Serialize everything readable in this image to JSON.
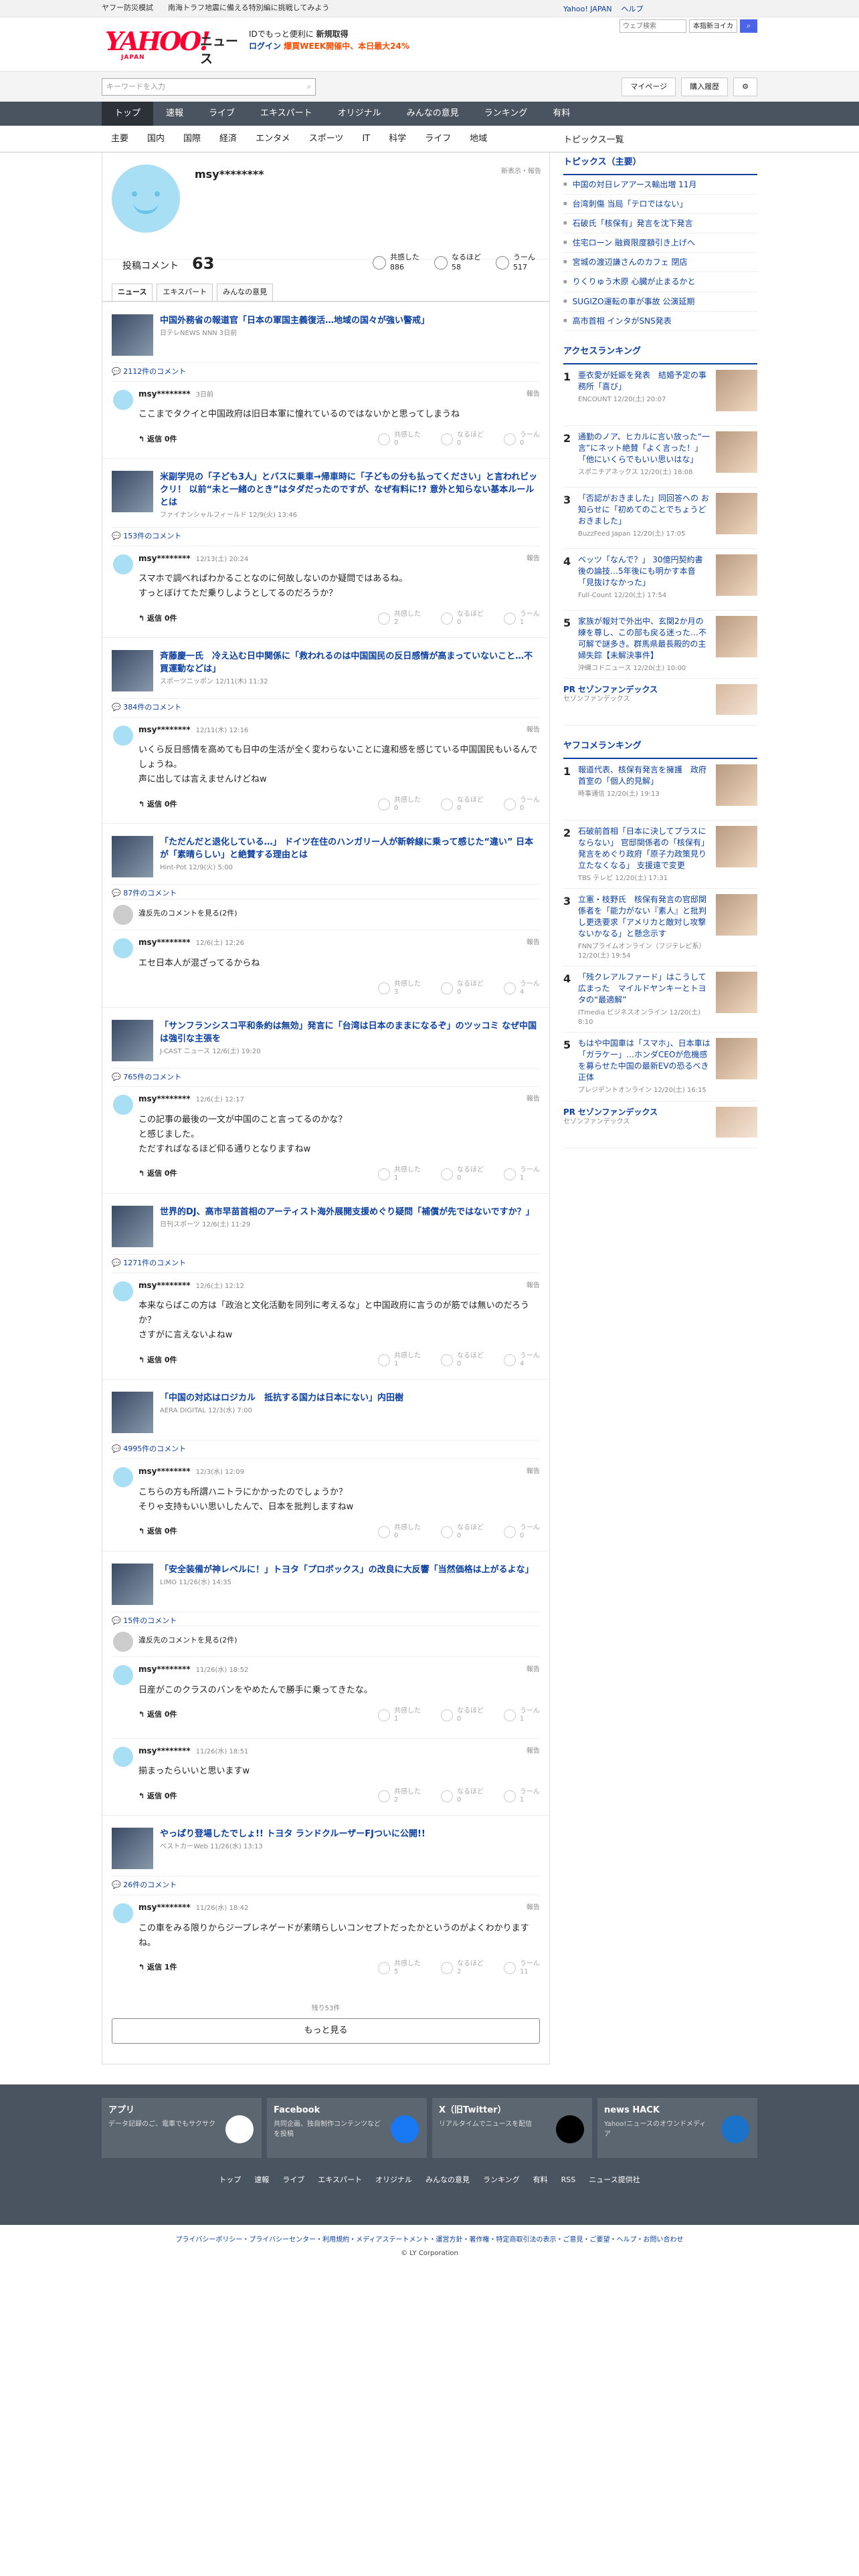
{
  "topbar": {
    "left": [
      "ヤフー防災模試",
      "南海トラフ地震に備える特別編に挑戦してみよう"
    ],
    "right": [
      "Yahoo! JAPAN",
      "ヘルプ"
    ]
  },
  "header": {
    "logo": "YAHOO!",
    "logo_sub": "JAPAN",
    "service": "ニュース",
    "promo1": "IDでもっと便利に",
    "promo1b": "新規取得",
    "promo2": "ログイン",
    "promo2b": "爆買WEEK開催中、本日最大24%",
    "search_placeholder": "ウェブ検索",
    "search_scope": "本指新ヨイカ"
  },
  "searchrow": {
    "placeholder": "キーワードを入力",
    "mypage": "マイページ",
    "history": "購入履歴"
  },
  "nav": [
    "トップ",
    "速報",
    "ライブ",
    "エキスパート",
    "オリジナル",
    "みんなの意見",
    "ランキング",
    "有料"
  ],
  "subnav": [
    "主要",
    "国内",
    "国際",
    "経済",
    "エンタメ",
    "スポーツ",
    "IT",
    "科学",
    "ライフ",
    "地域"
  ],
  "subnav_right": "トピックス一覧",
  "profile": {
    "name": "msy********",
    "note": "新表示・報告",
    "posted_label": "投稿コメント",
    "posted": "63",
    "stats": [
      {
        "label": "共感した",
        "value": "886"
      },
      {
        "label": "なるほど",
        "value": "58"
      },
      {
        "label": "うーん",
        "value": "517"
      }
    ]
  },
  "tabs": [
    "ニュース",
    "エキスパート",
    "みんなの意見"
  ],
  "articles": [
    {
      "title": "中国外務省の報道官「日本の軍国主義復活…地域の国々が強い警戒」",
      "src": "日テレNEWS NNN 3日前",
      "count": "2112件のコメント",
      "comments": [
        {
          "user": "msy********",
          "time": "3日前",
          "text": "ここまでタクイと中国政府は旧日本軍に憧れているのではないかと思ってしまうね",
          "reply": "返信 0件",
          "r": [
            "0",
            "0",
            "0"
          ]
        }
      ]
    },
    {
      "title": "米副学児の「子ども3人」とバスに乗車→帰車時に「子どもの分も払ってください」と言われビックリ！ 以前“未と一緒のとき”はタダだったのですが、なぜ有料に!? 意外と知らない基本ルールとは",
      "src": "ファイナンシャルフィールド 12/9(火) 13:46",
      "count": "153件のコメント",
      "comments": [
        {
          "user": "msy********",
          "time": "12/13(土) 20:24",
          "text": "スマホで調べればわかることなのに何故しないのか疑問ではあるね。\nすっとぼけてただ乗りしようとしてるのだろうか？",
          "reply": "返信 0件",
          "r": [
            "2",
            "0",
            "1"
          ]
        }
      ]
    },
    {
      "title": "斉藤慶一氏　冷え込む日中関係に「救われるのは中国国民の反日感情が高まっていないこと…不買運動などは」",
      "src": "スポーツニッポン 12/11(木) 11:32",
      "count": "384件のコメント",
      "comments": [
        {
          "user": "msy********",
          "time": "12/11(木) 12:16",
          "text": "いくら反日感情を高めても日中の生活が全く変わらないことに違和感を感じている中国国民もいるんでしょうね。\n声に出しては言えませんけどねw",
          "reply": "返信 0件",
          "r": [
            "0",
            "0",
            "0"
          ]
        }
      ]
    },
    {
      "title": "「ただんだと退化している…」 ドイツ在住のハンガリー人が新幹線に乗って感じた“違い” 日本が「素晴らしい」と絶賛する理由とは",
      "src": "Hint-Pot 12/9(火) 5:00",
      "count": "87件のコメント",
      "hidden": "違反先のコメントを見る(2件)",
      "comments": [
        {
          "user": "msy********",
          "time": "12/6(土) 12:26",
          "text": "エセ日本人が混ざってるからね",
          "reply": "",
          "r": [
            "3",
            "0",
            "4"
          ]
        }
      ]
    },
    {
      "title": "「サンフランシスコ平和条約は無効」発言に「台湾は日本のままになるぞ」のツッコミ なぜ中国は強引な主張を",
      "src": "J-CAST ニュース 12/6(土) 19:20",
      "count": "765件のコメント",
      "comments": [
        {
          "user": "msy********",
          "time": "12/6(土) 12:17",
          "text": "この記事の最後の一文が中国のこと言ってるのかな？\nと感じました。\nただすればなるほど仰る通りとなりますねw",
          "reply": "返信 0件",
          "r": [
            "1",
            "0",
            "1"
          ]
        }
      ]
    },
    {
      "title": "世界的DJ、高市早苗首相のアーティスト海外展開支援めぐり疑問「補償が先ではないですか？」",
      "src": "日刊スポーツ 12/6(土) 11:29",
      "count": "1271件のコメント",
      "comments": [
        {
          "user": "msy********",
          "time": "12/6(土) 12:12",
          "text": "本来ならばこの方は「政治と文化活動を同列に考えるな」と中国政府に言うのが筋では無いのだろうか？\nさすがに言えないよねw",
          "reply": "返信 0件",
          "r": [
            "1",
            "0",
            "4"
          ]
        }
      ]
    },
    {
      "title": "「中国の対応はロジカル　抵抗する国力は日本にない」内田樹",
      "src": "AERA DIGITAL 12/3(水) 7:00",
      "count": "4995件のコメント",
      "comments": [
        {
          "user": "msy********",
          "time": "12/3(水) 12:09",
          "text": "こちらの方も所謂ハニトラにかかったのでしょうか？\nそりゃ支持もいい思いしたんで、日本を批判しますねw",
          "reply": "返信 0件",
          "r": [
            "0",
            "0",
            "0"
          ]
        }
      ]
    },
    {
      "title": "「安全装備が神レベルに！」トヨタ「プロボックス」の改良に大反響「当然価格は上がるよな」",
      "src": "LIMO 11/26(水) 14:35",
      "count": "15件のコメント",
      "hidden": "違反先のコメントを見る(2件)",
      "comments": [
        {
          "user": "msy********",
          "time": "11/26(水) 18:52",
          "text": "日産がこのクラスのバンをやめたんで勝手に乗ってきたな。",
          "reply": "返信 0件",
          "r": [
            "1",
            "0",
            "1"
          ]
        },
        {
          "user": "msy********",
          "time": "11/26(水) 18:51",
          "text": "揃まったらいいと思いますw",
          "reply": "返信 0件",
          "r": [
            "2",
            "0",
            "1"
          ]
        }
      ]
    },
    {
      "title": "やっぱり登場したでしょ!! トヨタ ランドクルーザーFJついに公開!!",
      "src": "ベストカーWeb 11/26(水) 13:13",
      "count": "26件のコメント",
      "comments": [
        {
          "user": "msy********",
          "time": "11/26(水) 18:42",
          "text": "この車をみる限りからジープレネゲードが素晴らしいコンセプトだったかというのがよくわかりますね。",
          "reply": "返信 1件",
          "r": [
            "5",
            "2",
            "11"
          ]
        }
      ]
    }
  ],
  "react_labels": [
    "共感した",
    "なるほど",
    "うーん"
  ],
  "report": "報告",
  "more": {
    "rest": "残り53件",
    "button": "もっと見る"
  },
  "sidebar": {
    "topics_head": "トピックス（主要）",
    "topics": [
      "中国の対日レアアース輸出増 11月",
      "台湾刺傷 当局「テロではない」",
      "石破氏「核保有」発言を沈下発言",
      "住宅ローン 融資限度額引き上げへ",
      "宮城の渡辺謙さんのカフェ 閉店",
      "りくりゅう木原 心臓が止まるかと",
      "SUGIZO運転の車が事故 公演延期",
      "高市首相 インタがSNS発表"
    ],
    "access_head": "アクセスランキング",
    "access": [
      {
        "t": "亜衣愛が妊娠を発表　結婚予定の事務所「喜び」",
        "s": "ENCOUNT 12/20(土) 20:07"
      },
      {
        "t": "通勤のノア、ヒカルに言い放った“一言”にネット絶賛「よく言った！」「他にいくらでもいい思いはな」",
        "s": "スポニチアネックス 12/20(土) 18:08"
      },
      {
        "t": "「否認がおきました」同回答への お知らせに「初めてのことでちょうどおきました」",
        "s": "BuzzFeed Japan 12/20(土) 17:05"
      },
      {
        "t": "ベッツ「なんで？」 30億円契約書後の論技…5年後にも明かす本音「見抜けなかった」",
        "s": "Full-Count 12/20(土) 17:54"
      },
      {
        "t": "家族が報対で外出中、玄関2か月の練を尊し、この部も戻る迷った…不可解で謎多き。群馬県最長殿的の主婦失踪【未解決事件】",
        "s": "沖縄コドニュース 12/20(土) 10:00"
      }
    ],
    "pr1": {
      "label": "PR",
      "name": "セゾンファンデックス",
      "sub": "セゾンファンデックス"
    },
    "yahoo_head": "ヤフコメランキング",
    "yahoo": [
      {
        "t": "報道代表、核保有発言を擁護　政府首室の「個人的見解」",
        "s": "時事通信 12/20(土) 19:13"
      },
      {
        "t": "石破前首相「日本に決してプラスにならない」 官邸関係者の「核保有」発言をめぐり政府「原子力政策見り立たなくなる」 支援遠で変更",
        "s": "TBS テレビ 12/20(土) 17:31"
      },
      {
        "t": "立憲・枝野氏　核保有発言の官邸関係者を「能力がない『素人』と批判し更迭要求「アメリカと敵対し攻撃ないかなる」と懸念示す",
        "s": "FNNプライムオンライン（フジテレビ系） 12/20(土) 19:54"
      },
      {
        "t": "「残クレアルファード」はこうして広まった　マイルドヤンキーとトヨタの“最適解”",
        "s": "ITmedia ビジネスオンライン 12/20(土) 8:10"
      },
      {
        "t": "もはや中国車は「スマホ」、日本車は「ガラケー」…ホンダCEOが危機感を募らせた中国の最新EVの恐るべき正体",
        "s": "プレジデントオンライン 12/20(土) 16:15"
      }
    ],
    "pr2": {
      "label": "PR",
      "name": "セゾンファンデックス",
      "sub": "セゾンファンデックス"
    }
  },
  "footer": {
    "apps": [
      {
        "n": "アプリ",
        "d": "データ記録のご、電車でもサクサク"
      },
      {
        "n": "Facebook",
        "d": "共同企画、独自制作コンテンツなどを投稿"
      },
      {
        "n": "X（旧Twitter）",
        "d": "リアルタイムでニュースを配信"
      },
      {
        "n": "news HACK",
        "d": "Yahoo!ニュースのオウンドメディア"
      }
    ],
    "nav": [
      "トップ",
      "速報",
      "ライブ",
      "エキスパート",
      "オリジナル",
      "みんなの意見",
      "ランキング",
      "有料",
      "RSS",
      "ニュース提供社"
    ],
    "links": "プライバシーポリシー・プライバシーセンター・利用規約・メディアステートメント・運営方針・著作権・特定商取引法の表示・ご意見・ご要望・ヘルプ・お問い合わせ",
    "copy": "© LY Corporation"
  }
}
